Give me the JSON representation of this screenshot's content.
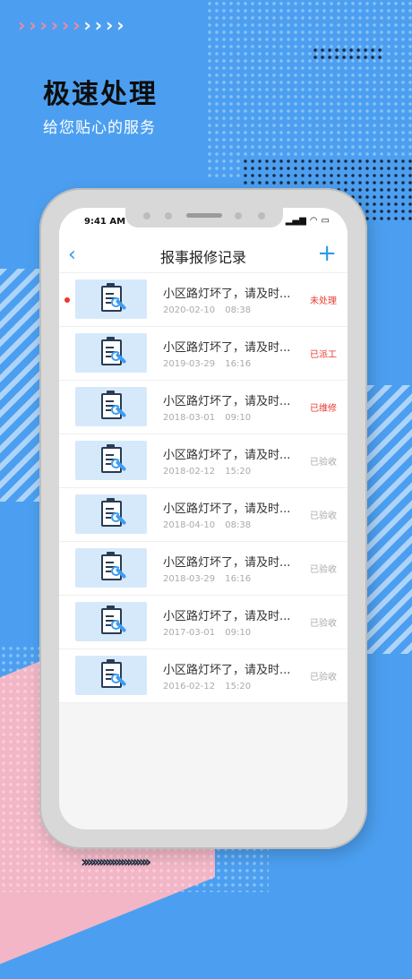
{
  "promo": {
    "headline": "极速处理",
    "subheadline": "给您贴心的服务"
  },
  "device": {
    "status_time": "9:41 AM"
  },
  "nav": {
    "title": "报事报修记录",
    "back_icon": "chevron-left-icon",
    "add_icon": "plus-icon"
  },
  "colors": {
    "accent": "#2a9ae8",
    "status_red": "#e8392f",
    "status_gray": "#aaaaaa",
    "background": "#4c9ff0",
    "pink": "#f2b6c6"
  },
  "records": [
    {
      "title": "小区路灯坏了，请及时...",
      "date": "2020-02-10",
      "time": "08:38",
      "status": "未处理",
      "status_type": "red",
      "unread": true
    },
    {
      "title": "小区路灯坏了，请及时...",
      "date": "2019-03-29",
      "time": "16:16",
      "status": "已派工",
      "status_type": "red",
      "unread": false
    },
    {
      "title": "小区路灯坏了，请及时...",
      "date": "2018-03-01",
      "time": "09:10",
      "status": "已维修",
      "status_type": "red",
      "unread": false
    },
    {
      "title": "小区路灯坏了，请及时...",
      "date": "2018-02-12",
      "time": "15:20",
      "status": "已验收",
      "status_type": "gray",
      "unread": false
    },
    {
      "title": "小区路灯坏了，请及时...",
      "date": "2018-04-10",
      "time": "08:38",
      "status": "已验收",
      "status_type": "gray",
      "unread": false
    },
    {
      "title": "小区路灯坏了，请及时...",
      "date": "2018-03-29",
      "time": "16:16",
      "status": "已验收",
      "status_type": "gray",
      "unread": false
    },
    {
      "title": "小区路灯坏了，请及时...",
      "date": "2017-03-01",
      "time": "09:10",
      "status": "已验收",
      "status_type": "gray",
      "unread": false
    },
    {
      "title": "小区路灯坏了，请及时...",
      "date": "2016-02-12",
      "time": "15:20",
      "status": "已验收",
      "status_type": "gray",
      "unread": false
    }
  ]
}
